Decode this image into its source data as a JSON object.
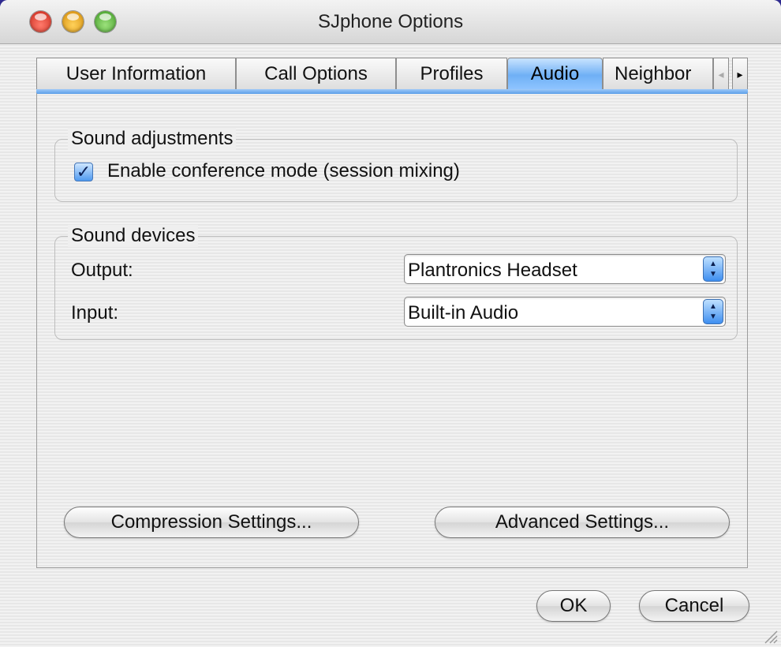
{
  "window": {
    "title": "SJphone Options"
  },
  "tabs": [
    {
      "label": "User Information"
    },
    {
      "label": "Call Options"
    },
    {
      "label": "Profiles"
    },
    {
      "label": "Audio"
    },
    {
      "label": "Neighbor"
    }
  ],
  "active_tab": "Audio",
  "sound_adjustments": {
    "title": "Sound adjustments",
    "conference_mode_label": "Enable conference mode (session mixing)",
    "conference_mode_checked": true
  },
  "sound_devices": {
    "title": "Sound devices",
    "output_label": "Output:",
    "output_value": "Plantronics Headset",
    "input_label": "Input:",
    "input_value": "Built-in Audio"
  },
  "buttons": {
    "compression": "Compression Settings...",
    "advanced": "Advanced Settings...",
    "ok": "OK",
    "cancel": "Cancel"
  },
  "colors": {
    "desktop": "#2e2a8f",
    "accent": "#5a9ee8"
  }
}
